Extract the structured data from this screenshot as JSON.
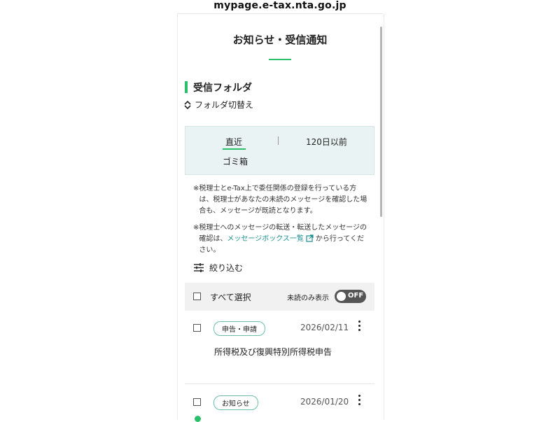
{
  "browser": {
    "url": "mypage.e-tax.nta.go.jp"
  },
  "page": {
    "title": "お知らせ・受信通知"
  },
  "folder": {
    "heading": "受信フォルダ",
    "switch_label": "フォルダ切替え"
  },
  "tabs": {
    "recent": "直近",
    "older": "120日以前",
    "trash": "ゴミ箱"
  },
  "notes": {
    "mark": "※",
    "note1": "税理士とe-Tax上で委任関係の登録を行っている方は、税理士があなたの未読のメッセージを確認した場合も、メッセージが既読となります。",
    "note2_before": "税理士へのメッセージの転送・転送したメッセージの確認は、",
    "note2_link": "メッセージボックス一覧",
    "note2_after": "から行ってください。"
  },
  "filter": {
    "label": "絞り込む"
  },
  "list_header": {
    "select_all": "すべて選択",
    "unread_only": "未読のみ表示",
    "toggle": "OFF"
  },
  "messages": [
    {
      "category": "申告・申請",
      "date": "2026/02/11",
      "subject": "所得税及び復興特別所得税申告",
      "unread": false
    },
    {
      "category": "お知らせ",
      "date": "2026/01/20",
      "subject": "",
      "unread": true
    }
  ],
  "colors": {
    "accent": "#2bbf6a",
    "link": "#1a8f8f",
    "tab_panel_bg": "#e9f3f3"
  }
}
